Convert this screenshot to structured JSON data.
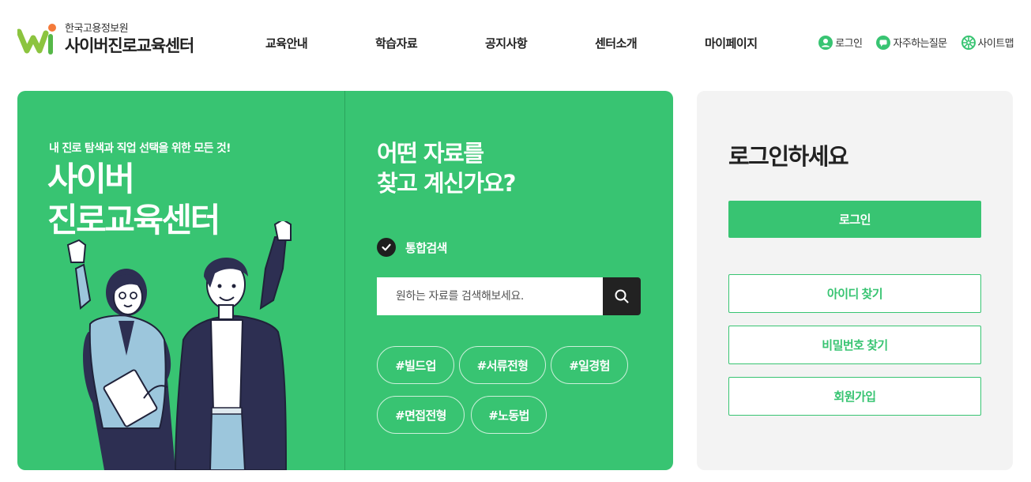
{
  "header": {
    "org_name": "한국고용정보원",
    "site_name": "사이버진로교육센터",
    "nav": [
      {
        "label": "교육안내"
      },
      {
        "label": "학습자료"
      },
      {
        "label": "공지사항"
      },
      {
        "label": "센터소개"
      },
      {
        "label": "마이페이지"
      }
    ],
    "util": [
      {
        "label": "로그인",
        "icon": "user-icon"
      },
      {
        "label": "자주하는질문",
        "icon": "chat-icon"
      },
      {
        "label": "사이트맵",
        "icon": "sitemap-icon"
      }
    ]
  },
  "hero": {
    "subtitle": "내 진로 탐색과 직업 선택을 위한 모든 것!",
    "title_line1": "사이버",
    "title_line2": "진로교육센터"
  },
  "search": {
    "question_line1": "어떤 자료를",
    "question_line2": "찾고 계신가요?",
    "scope_label": "통합검색",
    "placeholder": "원하는 자료를 검색해보세요.",
    "tags": [
      "#빌드업",
      "#서류전형",
      "#일경험",
      "#면접전형",
      "#노동법"
    ]
  },
  "login": {
    "title": "로그인하세요",
    "login_button": "로그인",
    "find_id": "아이디 찾기",
    "find_password": "비밀번호 찾기",
    "signup": "회원가입"
  },
  "colors": {
    "brand_green": "#38c472",
    "dark": "#222222",
    "panel_gray": "#f3f3f3",
    "logo_orange": "#f47a3a",
    "logo_green": "#8cc43f"
  }
}
